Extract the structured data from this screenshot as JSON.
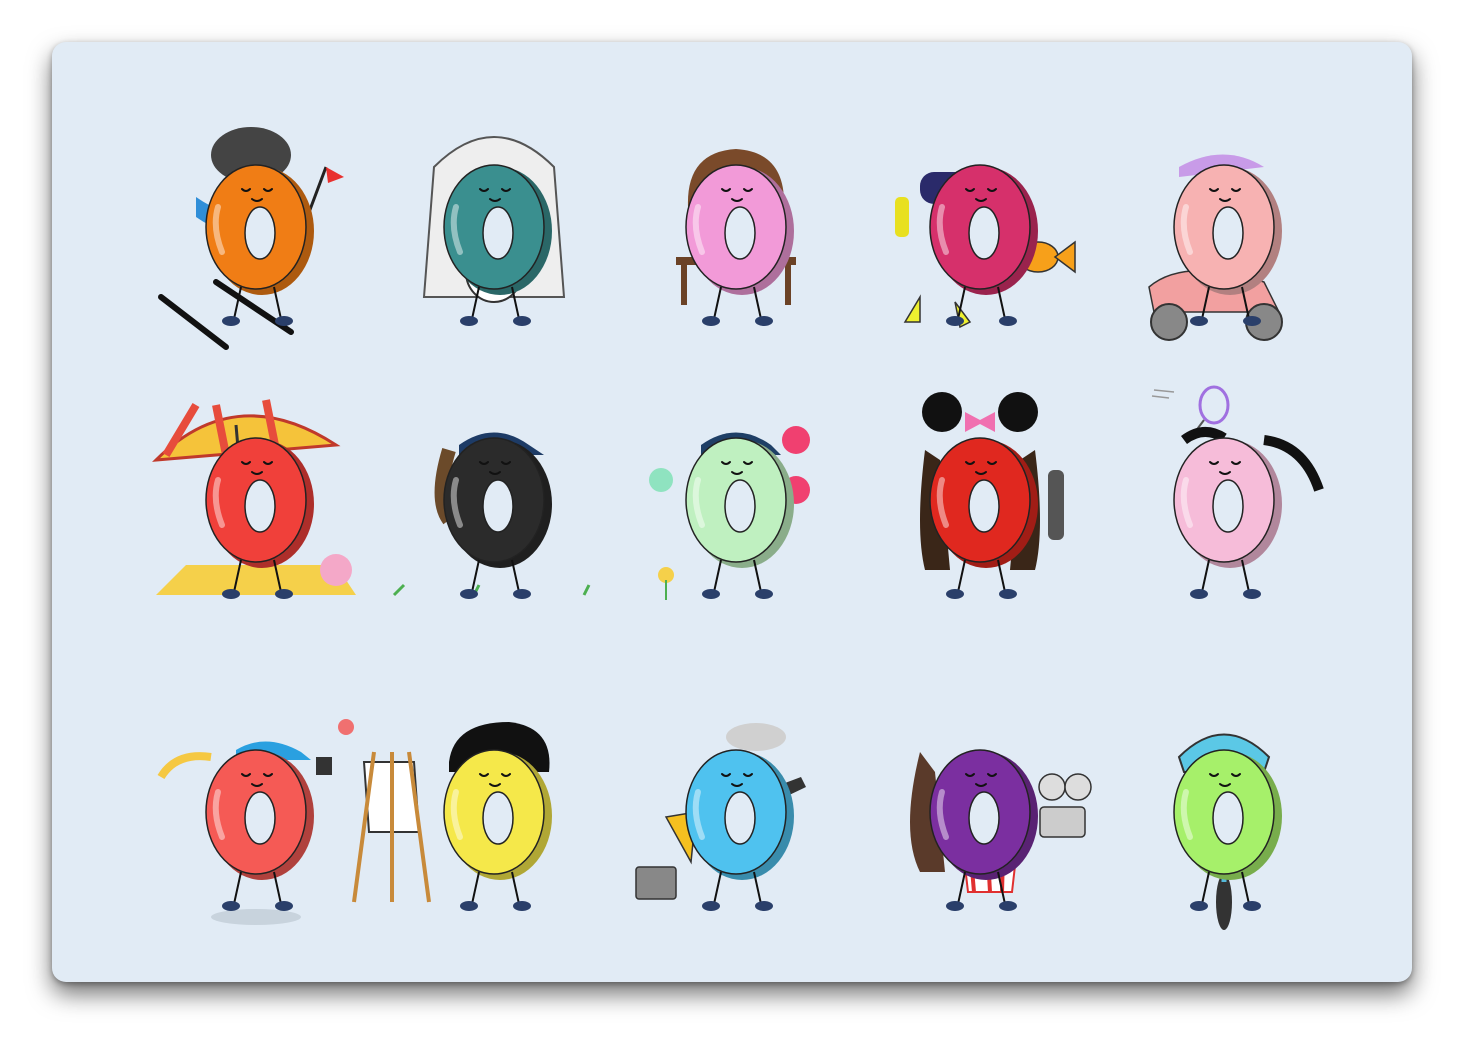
{
  "panel": {
    "background": "#e1ebf5"
  },
  "stickers": [
    {
      "activity": "skiing",
      "icon": "ski-icon",
      "donut_color": "#f07d15",
      "accent": "#2f8ed8"
    },
    {
      "activity": "cozy-with-cat",
      "icon": "cat-icon",
      "donut_color": "#3a8f8f",
      "accent": "#e8e8e8"
    },
    {
      "activity": "makeup",
      "icon": "lipstick-icon",
      "donut_color": "#f29ad8",
      "accent": "#7a4a2a"
    },
    {
      "activity": "snorkeling",
      "icon": "fish-icon",
      "donut_color": "#d6306b",
      "accent": "#f7a01a"
    },
    {
      "activity": "scooter",
      "icon": "scooter-icon",
      "donut_color": "#f7b2b2",
      "accent": "#c89be8"
    },
    {
      "activity": "beach",
      "icon": "umbrella-icon",
      "donut_color": "#f0403a",
      "accent": "#f5d04a"
    },
    {
      "activity": "golf",
      "icon": "golf-icon",
      "donut_color": "#2b2b2b",
      "accent": "#1d3b66"
    },
    {
      "activity": "family-walk",
      "icon": "flower-icon",
      "donut_color": "#bff0c0",
      "accent": "#1f3f66"
    },
    {
      "activity": "theme-park",
      "icon": "mouse-ears-icon",
      "donut_color": "#e0281f",
      "accent": "#f070b0"
    },
    {
      "activity": "badminton",
      "icon": "racket-icon",
      "donut_color": "#f6bcd9",
      "accent": "#a070e0"
    },
    {
      "activity": "running",
      "icon": "running-icon",
      "donut_color": "#f55a55",
      "accent": "#2aa0e0"
    },
    {
      "activity": "painting",
      "icon": "easel-icon",
      "donut_color": "#f5e84a",
      "accent": "#c88a3a"
    },
    {
      "activity": "guitar",
      "icon": "guitar-icon",
      "donut_color": "#4fc2ef",
      "accent": "#f5c020"
    },
    {
      "activity": "movies",
      "icon": "popcorn-icon",
      "donut_color": "#7b2fa0",
      "accent": "#e03030"
    },
    {
      "activity": "cycling",
      "icon": "bicycle-icon",
      "donut_color": "#a6f06a",
      "accent": "#5bc8e6"
    }
  ]
}
